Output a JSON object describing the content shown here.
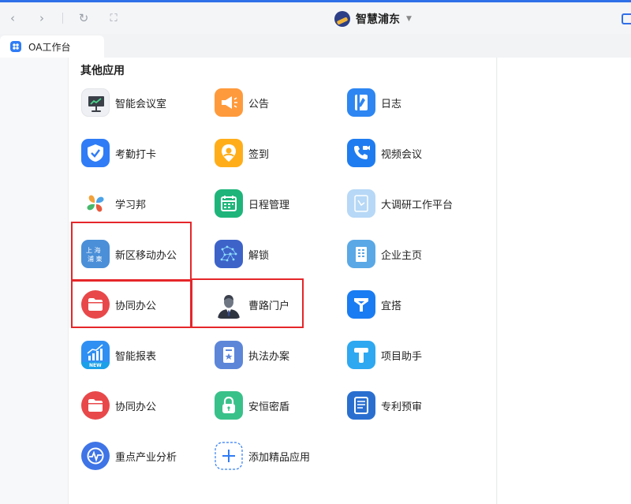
{
  "window": {
    "title": "智慧浦东"
  },
  "tab": {
    "label": "OA工作台"
  },
  "section": {
    "title": "其他应用"
  },
  "apps": [
    {
      "label": "智能会议室",
      "icon": "meeting-room-icon",
      "bg": "#eef0f3",
      "fg": "#3a3f48"
    },
    {
      "label": "公告",
      "icon": "megaphone-icon",
      "bg": "#ff9a3c",
      "fg": "#ffffff"
    },
    {
      "label": "日志",
      "icon": "journal-icon",
      "bg": "#2d86f2",
      "fg": "#ffffff"
    },
    {
      "label": "考勤打卡",
      "icon": "shield-check-icon",
      "bg": "#2f7cf6",
      "fg": "#ffffff"
    },
    {
      "label": "签到",
      "icon": "location-pin-icon",
      "bg": "#ffae1a",
      "fg": "#ffffff"
    },
    {
      "label": "视频会议",
      "icon": "video-call-icon",
      "bg": "#1f7cf0",
      "fg": "#ffffff"
    },
    {
      "label": "学习邦",
      "icon": "petals-icon",
      "bg": "#ffffff",
      "fg": "#e8593d"
    },
    {
      "label": "日程管理",
      "icon": "calendar-icon",
      "bg": "#1fb57a",
      "fg": "#ffffff"
    },
    {
      "label": "大调研工作平台",
      "icon": "research-platform-icon",
      "bg": "#b7d8f6",
      "fg": "#ffffff"
    },
    {
      "label": "新区移动办公",
      "icon": "shanghai-pudong-logo-icon",
      "bg": "#4a8fd8",
      "fg": "#ffffff"
    },
    {
      "label": "解锁",
      "icon": "network-unlock-icon",
      "bg": "#3d63c9",
      "fg": "#ffffff"
    },
    {
      "label": "企业主页",
      "icon": "building-icon",
      "bg": "#5aa8e6",
      "fg": "#ffffff"
    },
    {
      "label": "协同办公",
      "icon": "folder-icon",
      "bg": "#e8484a",
      "fg": "#ffffff"
    },
    {
      "label": "曹路门户",
      "icon": "portrait-icon",
      "bg": "#ffffff",
      "fg": "#2e3440"
    },
    {
      "label": "宜搭",
      "icon": "yida-icon",
      "bg": "#1a7cf2",
      "fg": "#ffffff"
    },
    {
      "label": "智能报表",
      "icon": "bar-chart-icon",
      "bg": "#2f8ff2",
      "fg": "#ffffff",
      "badge": "NEW"
    },
    {
      "label": "执法办案",
      "icon": "law-document-icon",
      "bg": "#5d86d9",
      "fg": "#ffffff"
    },
    {
      "label": "项目助手",
      "icon": "project-t-icon",
      "bg": "#2ea8f0",
      "fg": "#ffffff"
    },
    {
      "label": "协同办公",
      "icon": "folder-icon",
      "bg": "#e8484a",
      "fg": "#ffffff"
    },
    {
      "label": "安恒密盾",
      "icon": "lock-icon",
      "bg": "#39c18a",
      "fg": "#ffffff"
    },
    {
      "label": "专利预审",
      "icon": "patent-document-icon",
      "bg": "#2a6fd0",
      "fg": "#ffffff"
    },
    {
      "label": "重点产业分析",
      "icon": "pulse-chart-icon",
      "bg": "#3e74e6",
      "fg": "#ffffff"
    },
    {
      "label": "添加精品应用",
      "icon": "plus-icon",
      "bg": "#ffffff",
      "fg": "#2f7cf6"
    }
  ],
  "colors": {
    "highlight": "#e5262a",
    "accent": "#2f6fe8"
  }
}
